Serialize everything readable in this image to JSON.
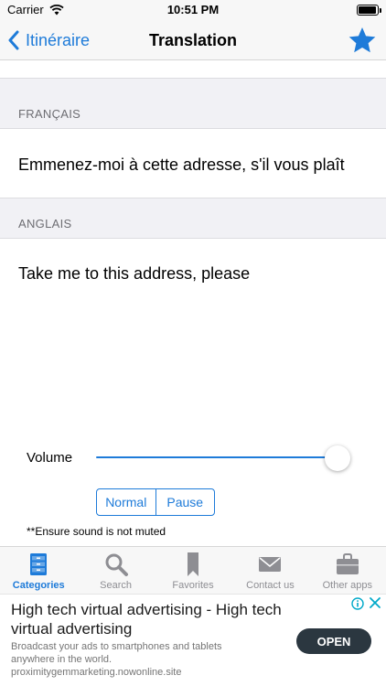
{
  "status_bar": {
    "carrier": "Carrier",
    "time": "10:51 PM"
  },
  "nav": {
    "back_label": "Itinéraire",
    "title": "Translation",
    "favorite_icon": "star-icon"
  },
  "source": {
    "header": "FRANÇAIS",
    "text": "Emmenez-moi à cette adresse, s'il vous plaît"
  },
  "target": {
    "header": "ANGLAIS",
    "text": "Take me to this address, please"
  },
  "volume": {
    "label": "Volume",
    "level": 1.0
  },
  "playback": {
    "normal_label": "Normal",
    "pause_label": "Pause"
  },
  "note": "**Ensure sound is not muted",
  "tabs": [
    {
      "label": "Categories",
      "icon": "cabinet-icon",
      "active": true
    },
    {
      "label": "Search",
      "icon": "search-icon",
      "active": false
    },
    {
      "label": "Favorites",
      "icon": "bookmark-icon",
      "active": false
    },
    {
      "label": "Contact us",
      "icon": "mail-icon",
      "active": false
    },
    {
      "label": "Other apps",
      "icon": "bag-icon",
      "active": false
    }
  ],
  "ad": {
    "headline": "High tech virtual advertising - High tech virtual advertising",
    "body": "Broadcast your ads to smartphones and tablets anywhere in the world.",
    "url": "proximitygemmarketing.nowonline.site",
    "cta": "OPEN"
  },
  "colors": {
    "accent": "#1e7bd9",
    "bar_bg": "#f7f7f7",
    "section_bg": "#f1f1f5",
    "inactive": "#8e8e93",
    "ad_button": "#2b3740"
  }
}
